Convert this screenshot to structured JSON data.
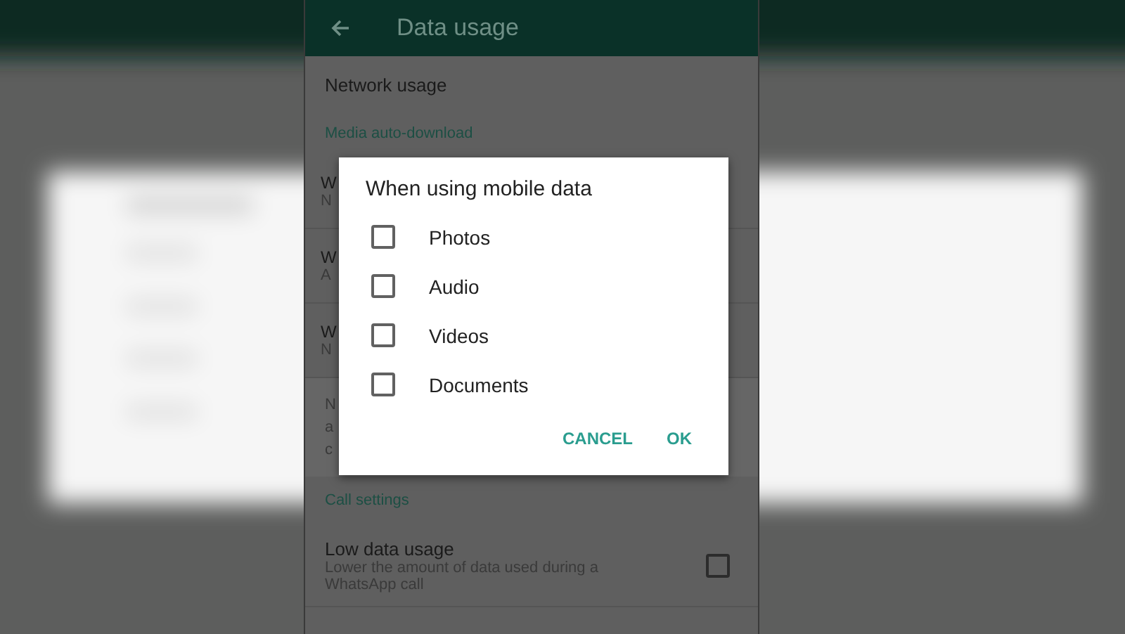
{
  "app_bar": {
    "title": "Data usage"
  },
  "network_usage": {
    "title": "Network usage"
  },
  "media_header": "Media auto-download",
  "media_rows": [
    {
      "title": "W",
      "subtitle": "N"
    },
    {
      "title": "W",
      "subtitle": "A"
    },
    {
      "title": "W",
      "subtitle": "N"
    }
  ],
  "note_lines": [
    "N",
    "a",
    "c"
  ],
  "call_header": "Call settings",
  "call_rows": [
    {
      "title": "Low data usage",
      "subtitle": "Lower the amount of data used during a WhatsApp call",
      "checked": false
    }
  ],
  "dialog": {
    "title": "When using mobile data",
    "options": [
      {
        "label": "Photos",
        "checked": false
      },
      {
        "label": "Audio",
        "checked": false
      },
      {
        "label": "Videos",
        "checked": false
      },
      {
        "label": "Documents",
        "checked": false
      }
    ],
    "buttons": [
      "CANCEL",
      "OK"
    ]
  }
}
